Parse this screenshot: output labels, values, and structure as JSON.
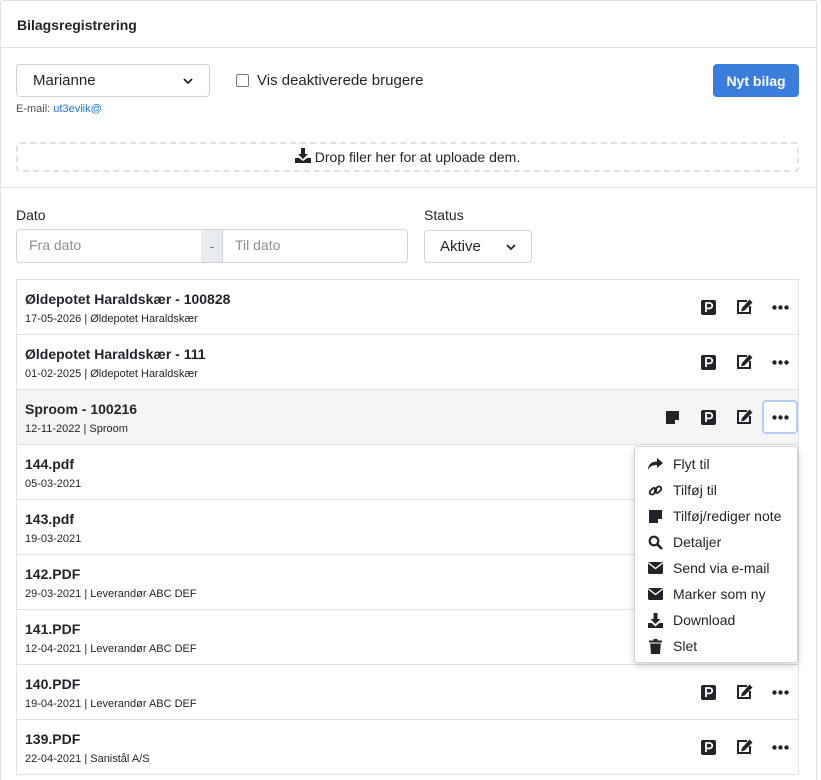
{
  "card": {
    "title": "Bilagsregistrering"
  },
  "user_select": {
    "value": "Marianne"
  },
  "show_inactive": {
    "label": "Vis deaktiverede brugere",
    "checked": false
  },
  "email": {
    "label": "E-mail:",
    "value": "ut3eviik@"
  },
  "new_button": {
    "label": "Nyt bilag"
  },
  "dropzone": {
    "label": "Drop filer her for at uploade dem."
  },
  "filters": {
    "date_label": "Dato",
    "from_placeholder": "Fra dato",
    "separator": "-",
    "to_placeholder": "Til dato",
    "status_label": "Status",
    "status_value": "Aktive"
  },
  "rows": [
    {
      "title": "Øldepotet Haraldskær - 100828",
      "sub": "17-05-2026 | Øldepotet Haraldskær"
    },
    {
      "title": "Øldepotet Haraldskær - 111",
      "sub": "01-02-2025 | Øldepotet Haraldskær"
    },
    {
      "title": "Sproom - 100216",
      "sub": "12-11-2022 | Sproom"
    },
    {
      "title": "144.pdf",
      "sub": "05-03-2021"
    },
    {
      "title": "143.pdf",
      "sub": "19-03-2021"
    },
    {
      "title": "142.PDF",
      "sub": "29-03-2021 | Leverandør ABC DEF"
    },
    {
      "title": "141.PDF",
      "sub": "12-04-2021 | Leverandør ABC DEF"
    },
    {
      "title": "140.PDF",
      "sub": "19-04-2021 | Leverandør ABC DEF"
    },
    {
      "title": "139.PDF",
      "sub": "22-04-2021 | Sanistål A/S"
    }
  ],
  "menu": {
    "items": [
      {
        "label": "Flyt til",
        "icon": "share-arrow-icon"
      },
      {
        "label": "Tilføj til",
        "icon": "link-icon"
      },
      {
        "label": "Tilføj/rediger note",
        "icon": "note-icon"
      },
      {
        "label": "Detaljer",
        "icon": "search-icon"
      },
      {
        "label": "Send via e-mail",
        "icon": "envelope-icon"
      },
      {
        "label": "Marker som ny",
        "icon": "envelope-icon"
      },
      {
        "label": "Download",
        "icon": "download-icon"
      },
      {
        "label": "Slet",
        "icon": "trash-icon"
      }
    ]
  },
  "colors": {
    "primary": "#3b7ddd",
    "link": "#1a73e8",
    "focus_ring": "#b3cdf7"
  }
}
